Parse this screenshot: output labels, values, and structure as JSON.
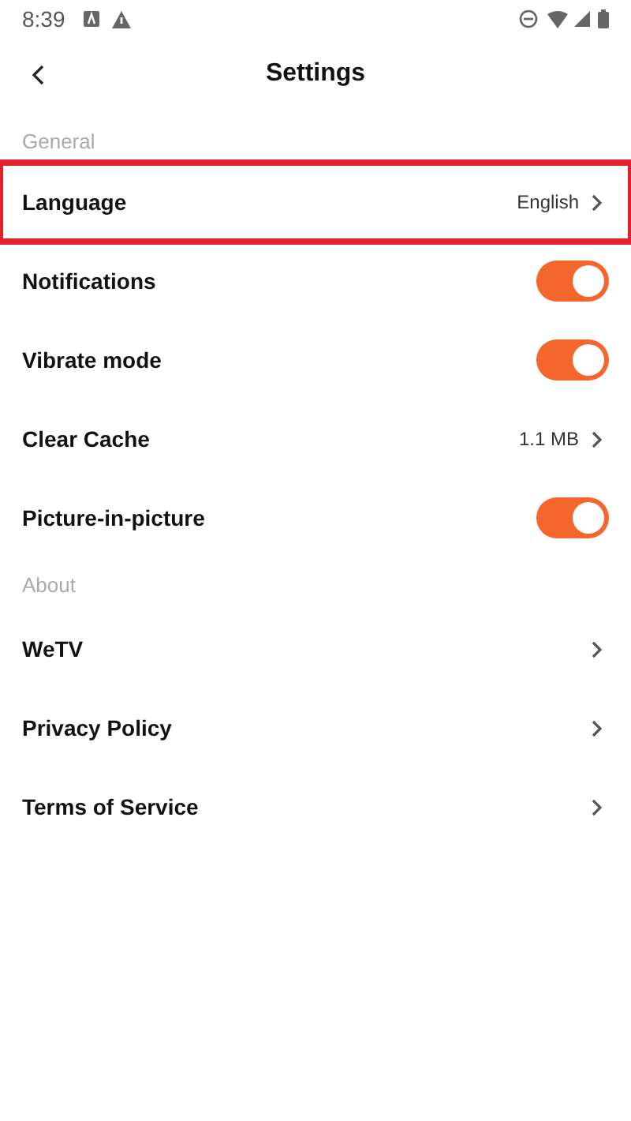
{
  "status_bar": {
    "time": "8:39"
  },
  "header": {
    "title": "Settings"
  },
  "sections": [
    {
      "title": "General",
      "items": [
        {
          "kind": "link",
          "label": "Language",
          "value": "English",
          "highlighted": true
        },
        {
          "kind": "toggle",
          "label": "Notifications",
          "on": true
        },
        {
          "kind": "toggle",
          "label": "Vibrate mode",
          "on": true
        },
        {
          "kind": "link",
          "label": "Clear Cache",
          "value": "1.1 MB"
        },
        {
          "kind": "toggle",
          "label": "Picture-in-picture",
          "on": true
        }
      ]
    },
    {
      "title": "About",
      "items": [
        {
          "kind": "link",
          "label": "WeTV"
        },
        {
          "kind": "link",
          "label": "Privacy Policy"
        },
        {
          "kind": "link",
          "label": "Terms of Service"
        }
      ]
    }
  ]
}
